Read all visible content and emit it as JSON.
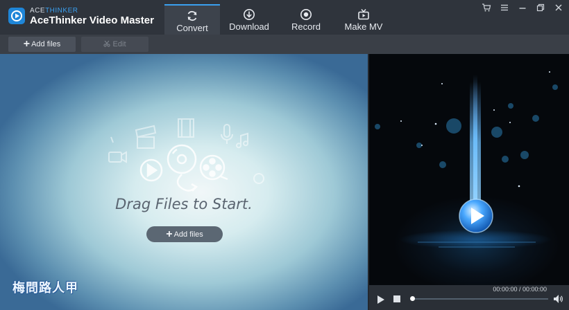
{
  "app": {
    "brand_small_1": "ACE",
    "brand_small_2": "THINKER",
    "title": "AceThinker Video Master"
  },
  "tabs": [
    {
      "label": "Convert",
      "icon": "refresh-icon",
      "active": true
    },
    {
      "label": "Download",
      "icon": "download-icon",
      "active": false
    },
    {
      "label": "Record",
      "icon": "record-icon",
      "active": false
    },
    {
      "label": "Make MV",
      "icon": "tv-icon",
      "active": false
    }
  ],
  "window_controls": [
    "cart-icon",
    "menu-icon",
    "minimize-icon",
    "restore-icon",
    "close-icon"
  ],
  "toolbar": {
    "add_files": "Add files",
    "edit": "Edit"
  },
  "dropzone": {
    "prompt": "Drag Files to Start.",
    "add_files": "Add files",
    "watermark": "梅問路人甲"
  },
  "player": {
    "time": "00:00:00 / 00:00:00",
    "progress": 0
  },
  "colors": {
    "accent": "#3aa0f0",
    "titlebar": "#2f343c",
    "toolbar": "#3a3f47"
  }
}
